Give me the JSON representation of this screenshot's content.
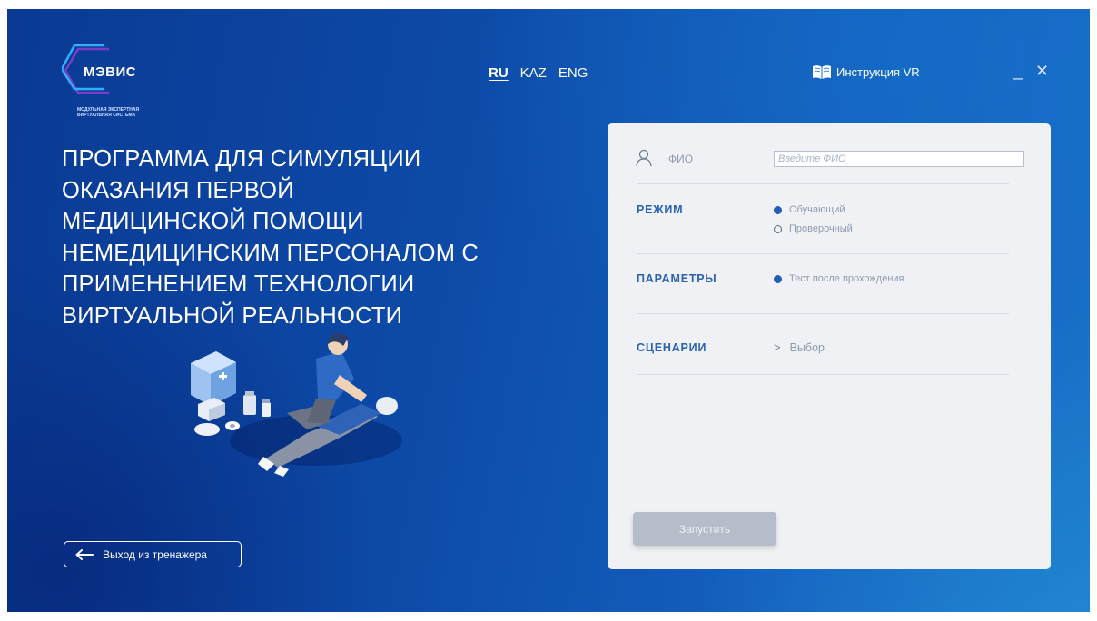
{
  "logo": {
    "name": "МЭВИС",
    "subtitle_line1": "МОДУЛЬНАЯ ЭКСПЕРТНАЯ",
    "subtitle_line2": "ВИРТУАЛЬНАЯ СИСТЕМА"
  },
  "languages": [
    {
      "label": "RU",
      "active": true
    },
    {
      "label": "KAZ",
      "active": false
    },
    {
      "label": "ENG",
      "active": false
    }
  ],
  "header": {
    "instruction_label": "Инструкция VR",
    "instruction_icon": "book-icon",
    "minimize_symbol": "_",
    "close_symbol": "✕"
  },
  "title_lines": [
    "ПРОГРАММА ДЛЯ СИМУЛЯЦИИ",
    "ОКАЗАНИЯ ПЕРВОЙ",
    "МЕДИЦИНСКОЙ ПОМОЩИ",
    "НЕМЕДИЦИНСКИМ ПЕРСОНАЛОМ С",
    "ПРИМЕНЕНИЕМ ТЕХНОЛОГИИ",
    "ВИРТУАЛЬНОЙ РЕАЛЬНОСТИ"
  ],
  "exit": {
    "label": "Выход из тренажера",
    "icon": "arrow-left-icon"
  },
  "panel": {
    "fio": {
      "label": "ФИО",
      "icon": "user-icon",
      "placeholder": "Введите ФИО",
      "value": ""
    },
    "mode": {
      "label": "РЕЖИМ",
      "options": [
        {
          "label": "Обучающий",
          "selected": true
        },
        {
          "label": "Проверочный",
          "selected": false
        }
      ]
    },
    "params": {
      "label": "ПАРАМЕТРЫ",
      "options": [
        {
          "label": "Тест после прохождения",
          "selected": true
        }
      ]
    },
    "scenarios": {
      "label": "СЦЕНАРИИ",
      "choose_label": "Выбор",
      "chevron": ">"
    },
    "launch_label": "Запустить"
  },
  "colors": {
    "background": "#0d4aa8",
    "accent": "#2a63b1",
    "panel": "#f0f1f4",
    "launch_disabled": "#b6bcc9"
  }
}
